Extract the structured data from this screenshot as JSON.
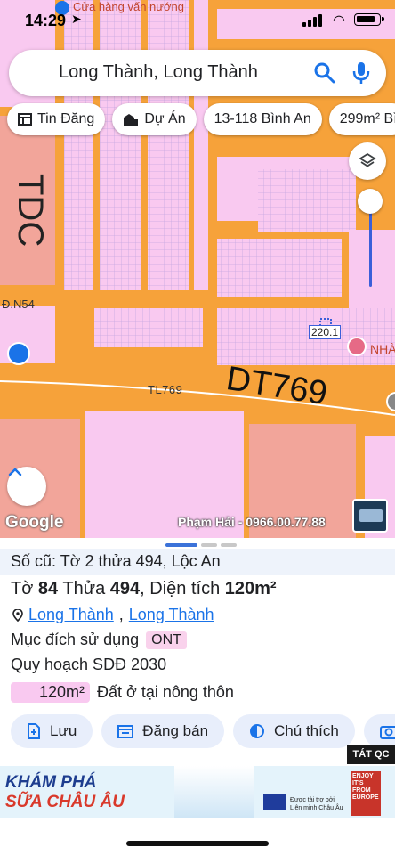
{
  "status_bar": {
    "time": "14:29"
  },
  "map": {
    "top_poi": "Cửa hàng vấn nướng",
    "labels": {
      "tdc": "TDC",
      "road_n54": "Đ.N54",
      "road_tl769": "TL769",
      "road_dt769": "DT769",
      "lot_tag": "220.1",
      "place_nha": "NHÀ"
    },
    "google_logo": "Google",
    "watermark": "Phạm Hải - 0966.00.77.88"
  },
  "search": {
    "query": "Long Thành, Long Thành"
  },
  "chips": [
    {
      "label": "Tin Đăng",
      "icon": "list-icon"
    },
    {
      "label": "Dự Án",
      "icon": "building-icon"
    },
    {
      "label": "13-118 Bình An",
      "icon": ""
    },
    {
      "label": "299m² Bì",
      "icon": ""
    }
  ],
  "sheet": {
    "old_number": "Số cũ: Tờ 2 thửa 494, Lộc An",
    "parcel": {
      "prefix_sheet": "Tờ",
      "sheet_no": "84",
      "prefix_plot": "Thửa",
      "plot_no": "494",
      "prefix_area": ", Diện tích",
      "area": "120m²"
    },
    "location": {
      "part1": "Long Thành",
      "part2": "Long Thành"
    },
    "purpose_label": "Mục đích sử dụng",
    "purpose_code": "ONT",
    "plan": "Quy hoạch SDĐ 2030",
    "legend_value": "120m²",
    "legend_text": "Đất ở tại nông thôn",
    "actions": [
      {
        "label": "Lưu",
        "icon": "add-doc-icon"
      },
      {
        "label": "Đăng bán",
        "icon": "calendar-icon"
      },
      {
        "label": "Chú thích",
        "icon": "contrast-icon"
      }
    ]
  },
  "ad": {
    "tag": "TÁT QC",
    "headline_1": "KHÁM PHÁ",
    "headline_2": "SỮA CHÂU ÂU",
    "eu_text": "Được tài trợ bởi Liên minh Châu Âu",
    "enjoy_text": "ENJOY IT'S FROM EUROPE"
  },
  "colors": {
    "road": "#f6a23a",
    "residential": "#f9c9f0",
    "accent": "#1a73e8",
    "sheet_highlight": "#eef3fb"
  }
}
